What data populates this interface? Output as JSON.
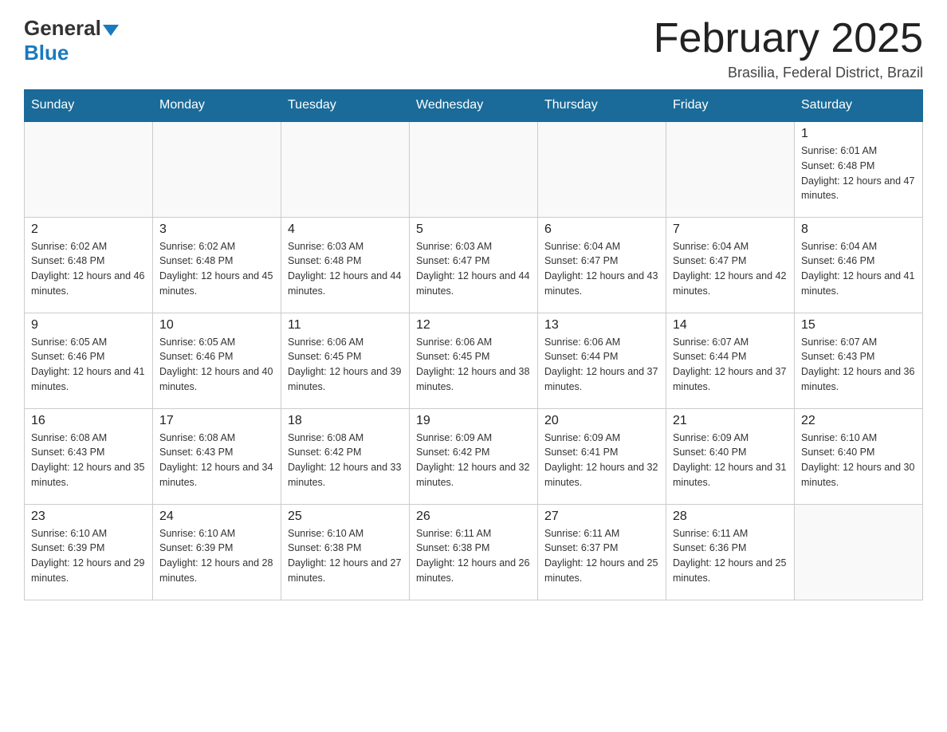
{
  "header": {
    "logo_general": "General",
    "logo_blue": "Blue",
    "month_title": "February 2025",
    "subtitle": "Brasilia, Federal District, Brazil"
  },
  "calendar": {
    "days_of_week": [
      "Sunday",
      "Monday",
      "Tuesday",
      "Wednesday",
      "Thursday",
      "Friday",
      "Saturday"
    ],
    "weeks": [
      [
        {
          "day": "",
          "info": ""
        },
        {
          "day": "",
          "info": ""
        },
        {
          "day": "",
          "info": ""
        },
        {
          "day": "",
          "info": ""
        },
        {
          "day": "",
          "info": ""
        },
        {
          "day": "",
          "info": ""
        },
        {
          "day": "1",
          "info": "Sunrise: 6:01 AM\nSunset: 6:48 PM\nDaylight: 12 hours and 47 minutes."
        }
      ],
      [
        {
          "day": "2",
          "info": "Sunrise: 6:02 AM\nSunset: 6:48 PM\nDaylight: 12 hours and 46 minutes."
        },
        {
          "day": "3",
          "info": "Sunrise: 6:02 AM\nSunset: 6:48 PM\nDaylight: 12 hours and 45 minutes."
        },
        {
          "day": "4",
          "info": "Sunrise: 6:03 AM\nSunset: 6:48 PM\nDaylight: 12 hours and 44 minutes."
        },
        {
          "day": "5",
          "info": "Sunrise: 6:03 AM\nSunset: 6:47 PM\nDaylight: 12 hours and 44 minutes."
        },
        {
          "day": "6",
          "info": "Sunrise: 6:04 AM\nSunset: 6:47 PM\nDaylight: 12 hours and 43 minutes."
        },
        {
          "day": "7",
          "info": "Sunrise: 6:04 AM\nSunset: 6:47 PM\nDaylight: 12 hours and 42 minutes."
        },
        {
          "day": "8",
          "info": "Sunrise: 6:04 AM\nSunset: 6:46 PM\nDaylight: 12 hours and 41 minutes."
        }
      ],
      [
        {
          "day": "9",
          "info": "Sunrise: 6:05 AM\nSunset: 6:46 PM\nDaylight: 12 hours and 41 minutes."
        },
        {
          "day": "10",
          "info": "Sunrise: 6:05 AM\nSunset: 6:46 PM\nDaylight: 12 hours and 40 minutes."
        },
        {
          "day": "11",
          "info": "Sunrise: 6:06 AM\nSunset: 6:45 PM\nDaylight: 12 hours and 39 minutes."
        },
        {
          "day": "12",
          "info": "Sunrise: 6:06 AM\nSunset: 6:45 PM\nDaylight: 12 hours and 38 minutes."
        },
        {
          "day": "13",
          "info": "Sunrise: 6:06 AM\nSunset: 6:44 PM\nDaylight: 12 hours and 37 minutes."
        },
        {
          "day": "14",
          "info": "Sunrise: 6:07 AM\nSunset: 6:44 PM\nDaylight: 12 hours and 37 minutes."
        },
        {
          "day": "15",
          "info": "Sunrise: 6:07 AM\nSunset: 6:43 PM\nDaylight: 12 hours and 36 minutes."
        }
      ],
      [
        {
          "day": "16",
          "info": "Sunrise: 6:08 AM\nSunset: 6:43 PM\nDaylight: 12 hours and 35 minutes."
        },
        {
          "day": "17",
          "info": "Sunrise: 6:08 AM\nSunset: 6:43 PM\nDaylight: 12 hours and 34 minutes."
        },
        {
          "day": "18",
          "info": "Sunrise: 6:08 AM\nSunset: 6:42 PM\nDaylight: 12 hours and 33 minutes."
        },
        {
          "day": "19",
          "info": "Sunrise: 6:09 AM\nSunset: 6:42 PM\nDaylight: 12 hours and 32 minutes."
        },
        {
          "day": "20",
          "info": "Sunrise: 6:09 AM\nSunset: 6:41 PM\nDaylight: 12 hours and 32 minutes."
        },
        {
          "day": "21",
          "info": "Sunrise: 6:09 AM\nSunset: 6:40 PM\nDaylight: 12 hours and 31 minutes."
        },
        {
          "day": "22",
          "info": "Sunrise: 6:10 AM\nSunset: 6:40 PM\nDaylight: 12 hours and 30 minutes."
        }
      ],
      [
        {
          "day": "23",
          "info": "Sunrise: 6:10 AM\nSunset: 6:39 PM\nDaylight: 12 hours and 29 minutes."
        },
        {
          "day": "24",
          "info": "Sunrise: 6:10 AM\nSunset: 6:39 PM\nDaylight: 12 hours and 28 minutes."
        },
        {
          "day": "25",
          "info": "Sunrise: 6:10 AM\nSunset: 6:38 PM\nDaylight: 12 hours and 27 minutes."
        },
        {
          "day": "26",
          "info": "Sunrise: 6:11 AM\nSunset: 6:38 PM\nDaylight: 12 hours and 26 minutes."
        },
        {
          "day": "27",
          "info": "Sunrise: 6:11 AM\nSunset: 6:37 PM\nDaylight: 12 hours and 25 minutes."
        },
        {
          "day": "28",
          "info": "Sunrise: 6:11 AM\nSunset: 6:36 PM\nDaylight: 12 hours and 25 minutes."
        },
        {
          "day": "",
          "info": ""
        }
      ]
    ]
  }
}
